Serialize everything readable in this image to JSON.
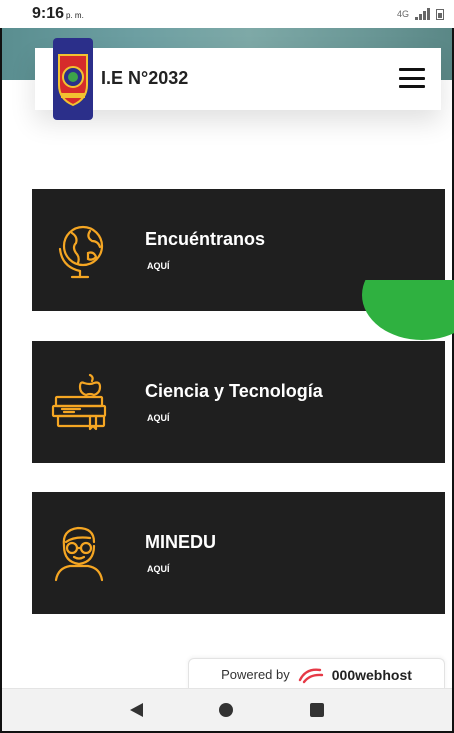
{
  "status_bar": {
    "time": "9:16",
    "time_suffix": "p. m.",
    "network": "4G"
  },
  "header": {
    "site_title": "I.E N°2032"
  },
  "cards": [
    {
      "title": "Encuéntranos",
      "link": "AQUÍ",
      "icon": "globe-icon"
    },
    {
      "title": "Ciencia y Tecnología",
      "link": "AQUÍ",
      "icon": "books-apple-icon"
    },
    {
      "title": "MINEDU",
      "link": "AQUÍ",
      "icon": "student-icon"
    }
  ],
  "footer": {
    "powered_label": "Powered by",
    "powered_brand": "000webhost"
  },
  "colors": {
    "card_bg": "#1f1f1f",
    "icon_accent": "#f5a623",
    "whatsapp_green": "#2fb140"
  }
}
